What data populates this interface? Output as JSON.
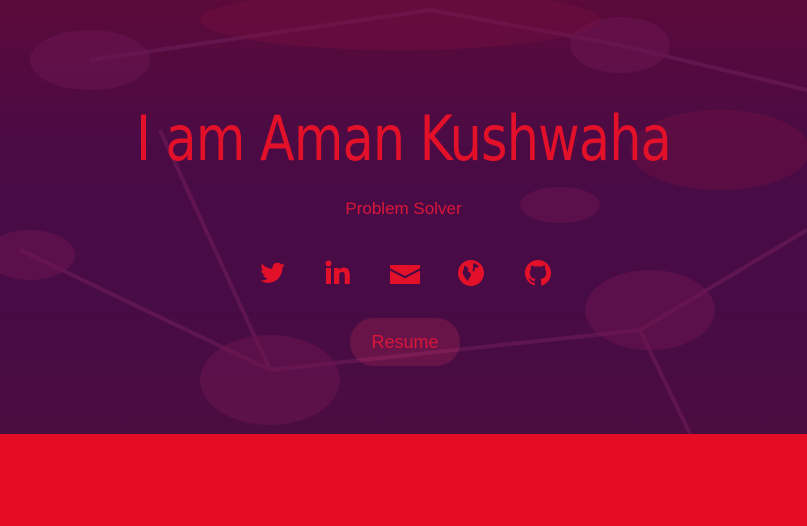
{
  "hero": {
    "title": "I am Aman Kushwaha",
    "subtitle": "Problem Solver",
    "resume_label": "Resume"
  },
  "social": [
    {
      "icon": "twitter-icon"
    },
    {
      "icon": "linkedin-icon"
    },
    {
      "icon": "envelope-icon"
    },
    {
      "icon": "globe-icon"
    },
    {
      "icon": "github-icon"
    }
  ],
  "colors": {
    "accent": "#e3102a",
    "hero_background": "#4a0b45",
    "footer_band": "#e50d24"
  }
}
